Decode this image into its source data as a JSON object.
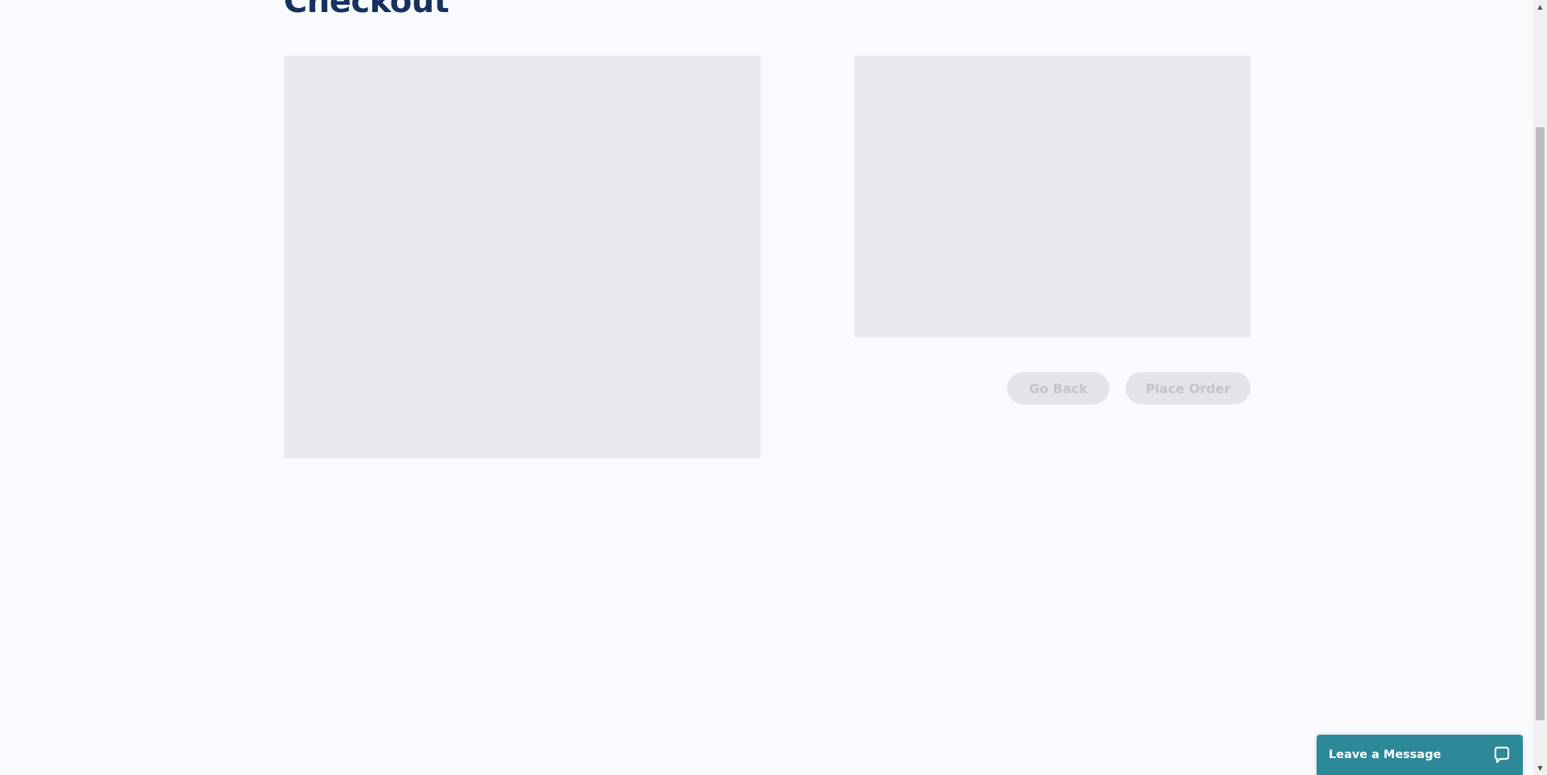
{
  "page": {
    "title": "Checkout"
  },
  "actions": {
    "go_back_label": "Go Back",
    "place_order_label": "Place Order"
  },
  "chat_widget": {
    "label": "Leave a Message",
    "icon": "chat-bubble-icon",
    "color": "#2d8898"
  },
  "colors": {
    "title": "#16315f",
    "background": "#f9fafe",
    "skeleton": "#e9eaee"
  }
}
